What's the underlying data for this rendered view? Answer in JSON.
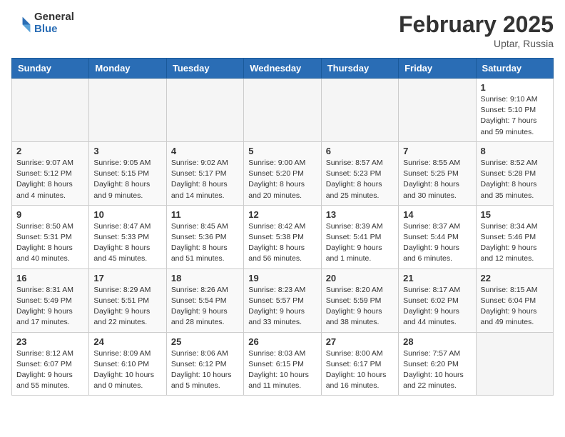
{
  "header": {
    "logo_general": "General",
    "logo_blue": "Blue",
    "month_title": "February 2025",
    "location": "Uptar, Russia"
  },
  "days_of_week": [
    "Sunday",
    "Monday",
    "Tuesday",
    "Wednesday",
    "Thursday",
    "Friday",
    "Saturday"
  ],
  "weeks": [
    [
      {
        "day": "",
        "info": ""
      },
      {
        "day": "",
        "info": ""
      },
      {
        "day": "",
        "info": ""
      },
      {
        "day": "",
        "info": ""
      },
      {
        "day": "",
        "info": ""
      },
      {
        "day": "",
        "info": ""
      },
      {
        "day": "1",
        "info": "Sunrise: 9:10 AM\nSunset: 5:10 PM\nDaylight: 7 hours and 59 minutes."
      }
    ],
    [
      {
        "day": "2",
        "info": "Sunrise: 9:07 AM\nSunset: 5:12 PM\nDaylight: 8 hours and 4 minutes."
      },
      {
        "day": "3",
        "info": "Sunrise: 9:05 AM\nSunset: 5:15 PM\nDaylight: 8 hours and 9 minutes."
      },
      {
        "day": "4",
        "info": "Sunrise: 9:02 AM\nSunset: 5:17 PM\nDaylight: 8 hours and 14 minutes."
      },
      {
        "day": "5",
        "info": "Sunrise: 9:00 AM\nSunset: 5:20 PM\nDaylight: 8 hours and 20 minutes."
      },
      {
        "day": "6",
        "info": "Sunrise: 8:57 AM\nSunset: 5:23 PM\nDaylight: 8 hours and 25 minutes."
      },
      {
        "day": "7",
        "info": "Sunrise: 8:55 AM\nSunset: 5:25 PM\nDaylight: 8 hours and 30 minutes."
      },
      {
        "day": "8",
        "info": "Sunrise: 8:52 AM\nSunset: 5:28 PM\nDaylight: 8 hours and 35 minutes."
      }
    ],
    [
      {
        "day": "9",
        "info": "Sunrise: 8:50 AM\nSunset: 5:31 PM\nDaylight: 8 hours and 40 minutes."
      },
      {
        "day": "10",
        "info": "Sunrise: 8:47 AM\nSunset: 5:33 PM\nDaylight: 8 hours and 45 minutes."
      },
      {
        "day": "11",
        "info": "Sunrise: 8:45 AM\nSunset: 5:36 PM\nDaylight: 8 hours and 51 minutes."
      },
      {
        "day": "12",
        "info": "Sunrise: 8:42 AM\nSunset: 5:38 PM\nDaylight: 8 hours and 56 minutes."
      },
      {
        "day": "13",
        "info": "Sunrise: 8:39 AM\nSunset: 5:41 PM\nDaylight: 9 hours and 1 minute."
      },
      {
        "day": "14",
        "info": "Sunrise: 8:37 AM\nSunset: 5:44 PM\nDaylight: 9 hours and 6 minutes."
      },
      {
        "day": "15",
        "info": "Sunrise: 8:34 AM\nSunset: 5:46 PM\nDaylight: 9 hours and 12 minutes."
      }
    ],
    [
      {
        "day": "16",
        "info": "Sunrise: 8:31 AM\nSunset: 5:49 PM\nDaylight: 9 hours and 17 minutes."
      },
      {
        "day": "17",
        "info": "Sunrise: 8:29 AM\nSunset: 5:51 PM\nDaylight: 9 hours and 22 minutes."
      },
      {
        "day": "18",
        "info": "Sunrise: 8:26 AM\nSunset: 5:54 PM\nDaylight: 9 hours and 28 minutes."
      },
      {
        "day": "19",
        "info": "Sunrise: 8:23 AM\nSunset: 5:57 PM\nDaylight: 9 hours and 33 minutes."
      },
      {
        "day": "20",
        "info": "Sunrise: 8:20 AM\nSunset: 5:59 PM\nDaylight: 9 hours and 38 minutes."
      },
      {
        "day": "21",
        "info": "Sunrise: 8:17 AM\nSunset: 6:02 PM\nDaylight: 9 hours and 44 minutes."
      },
      {
        "day": "22",
        "info": "Sunrise: 8:15 AM\nSunset: 6:04 PM\nDaylight: 9 hours and 49 minutes."
      }
    ],
    [
      {
        "day": "23",
        "info": "Sunrise: 8:12 AM\nSunset: 6:07 PM\nDaylight: 9 hours and 55 minutes."
      },
      {
        "day": "24",
        "info": "Sunrise: 8:09 AM\nSunset: 6:10 PM\nDaylight: 10 hours and 0 minutes."
      },
      {
        "day": "25",
        "info": "Sunrise: 8:06 AM\nSunset: 6:12 PM\nDaylight: 10 hours and 5 minutes."
      },
      {
        "day": "26",
        "info": "Sunrise: 8:03 AM\nSunset: 6:15 PM\nDaylight: 10 hours and 11 minutes."
      },
      {
        "day": "27",
        "info": "Sunrise: 8:00 AM\nSunset: 6:17 PM\nDaylight: 10 hours and 16 minutes."
      },
      {
        "day": "28",
        "info": "Sunrise: 7:57 AM\nSunset: 6:20 PM\nDaylight: 10 hours and 22 minutes."
      },
      {
        "day": "",
        "info": ""
      }
    ]
  ]
}
